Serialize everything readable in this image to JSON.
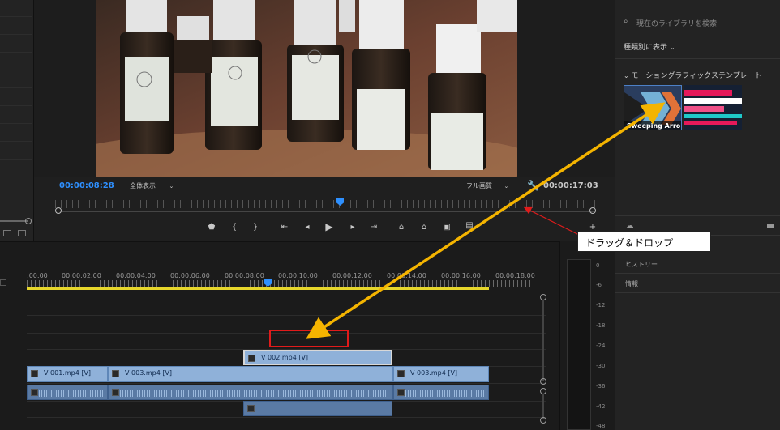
{
  "monitor": {
    "current_timecode": "00:00:08:28",
    "zoom_select": "全体表示",
    "quality_select": "フル画質",
    "duration_timecode": "00:00:17:03"
  },
  "library": {
    "search_placeholder": "現在のライブラリを検索",
    "view_toggle": "種類別に表示",
    "section_title": "モーショングラフィックステンプレート",
    "thumbnails": [
      {
        "label": "Sweeping Arro..."
      },
      {
        "label": ""
      }
    ],
    "history_label": "ヒストリー",
    "info_label": "情報"
  },
  "timeline": {
    "ruler_ticks": [
      ":00:00",
      "00:00:02:00",
      "00:00:04:00",
      "00:00:06:00",
      "00:00:08:00",
      "00:00:10:00",
      "00:00:12:00",
      "00:00:14:00",
      "00:00:16:00",
      "00:00:18:00"
    ],
    "clips": {
      "v2": "V 002.mp4 [V]",
      "v1_a": "V 001.mp4 [V]",
      "v1_b": "V 003.mp4 [V]",
      "v1_c": "V 003.mp4 [V]"
    }
  },
  "meter": {
    "labels": [
      "0",
      "-6",
      "-12",
      "-18",
      "-24",
      "-30",
      "-36",
      "-42",
      "-48"
    ]
  },
  "annotation": {
    "callout_text": "ドラッグ＆ドロップ",
    "arrow_color": "#f4b400",
    "callout_arrow_color": "#e11b1b"
  }
}
